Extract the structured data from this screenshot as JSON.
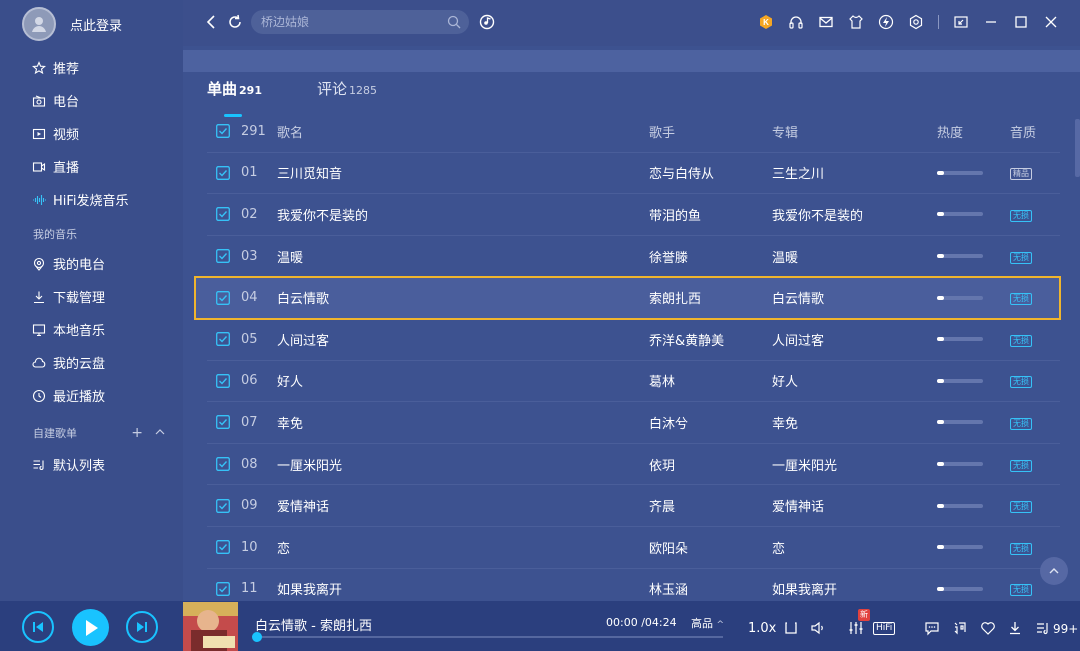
{
  "user": {
    "login_label": "点此登录"
  },
  "sidebar": {
    "nav": [
      {
        "label": "推荐",
        "icon": "star-icon"
      },
      {
        "label": "电台",
        "icon": "radio-icon"
      },
      {
        "label": "视频",
        "icon": "video-icon"
      },
      {
        "label": "直播",
        "icon": "live-icon"
      },
      {
        "label": "HiFi发烧音乐",
        "icon": "waveform-icon"
      }
    ],
    "my_music_title": "我的音乐",
    "my_music": [
      {
        "label": "我的电台",
        "icon": "location-icon"
      },
      {
        "label": "下载管理",
        "icon": "download-icon"
      },
      {
        "label": "本地音乐",
        "icon": "monitor-icon"
      },
      {
        "label": "我的云盘",
        "icon": "cloud-icon"
      },
      {
        "label": "最近播放",
        "icon": "clock-icon"
      }
    ],
    "playlists_title": "自建歌单",
    "playlists": [
      {
        "label": "默认列表",
        "icon": "playlist-icon"
      }
    ]
  },
  "search": {
    "placeholder": "桥边姑娘"
  },
  "tabs": [
    {
      "label": "单曲",
      "count": "291"
    },
    {
      "label": "评论",
      "count": "1285"
    }
  ],
  "table": {
    "header": {
      "count": "291",
      "title": "歌名",
      "artist": "歌手",
      "album": "专辑",
      "heat": "热度",
      "quality": "音质"
    },
    "rows": [
      {
        "num": "01",
        "title": "三川觅知音",
        "artist": "恋与白侍从",
        "album": "三生之川",
        "heat": 0.15,
        "quality": "精品"
      },
      {
        "num": "02",
        "title": "我爱你不是装的",
        "artist": "带泪的鱼",
        "album": "我爱你不是装的",
        "heat": 0.15,
        "quality": "无损"
      },
      {
        "num": "03",
        "title": "温暖",
        "artist": "徐誉滕",
        "album": "温暖",
        "heat": 0.15,
        "quality": "无损"
      },
      {
        "num": "04",
        "title": "白云情歌",
        "artist": "索朗扎西",
        "album": "白云情歌",
        "heat": 0.15,
        "quality": "无损"
      },
      {
        "num": "05",
        "title": "人间过客",
        "artist": "乔洋&黄静美",
        "album": "人间过客",
        "heat": 0.15,
        "quality": "无损"
      },
      {
        "num": "06",
        "title": "好人",
        "artist": "葛林",
        "album": "好人",
        "heat": 0.15,
        "quality": "无损"
      },
      {
        "num": "07",
        "title": "幸免",
        "artist": "白沐兮",
        "album": "幸免",
        "heat": 0.15,
        "quality": "无损"
      },
      {
        "num": "08",
        "title": "一厘米阳光",
        "artist": "依玥",
        "album": "一厘米阳光",
        "heat": 0.15,
        "quality": "无损"
      },
      {
        "num": "09",
        "title": "爱情神话",
        "artist": "齐晨",
        "album": "爱情神话",
        "heat": 0.15,
        "quality": "无损"
      },
      {
        "num": "10",
        "title": "恋",
        "artist": "欧阳朵",
        "album": "恋",
        "heat": 0.15,
        "quality": "无损"
      },
      {
        "num": "11",
        "title": "如果我离开",
        "artist": "林玉涵",
        "album": "如果我离开",
        "heat": 0.15,
        "quality": "无损"
      }
    ]
  },
  "player": {
    "title": "白云情歌 - 索朗扎西",
    "time": "00:00 /04:24",
    "quality": "高品",
    "speed": "1.0x",
    "new_badge": "新",
    "hifi": "HiFi",
    "queue_count": "99+",
    "progress": 0.0
  },
  "colors": {
    "accent": "#19c3ff",
    "highlight": "#f0b52d",
    "bg": "#3c4f8c"
  }
}
